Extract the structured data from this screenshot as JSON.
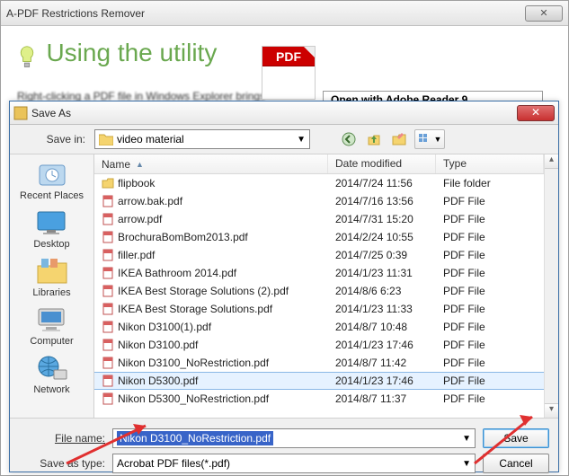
{
  "app": {
    "title": "A-PDF Restrictions Remover",
    "heading": "Using the utility",
    "desc": "Right-clicking a PDF file in Windows Explorer brings",
    "pdf_badge": "PDF",
    "context_item": "Open with Adobe Reader 9"
  },
  "dialog": {
    "title": "Save As",
    "savein_label": "Save in:",
    "folder": "video material",
    "places": [
      {
        "label": "Recent Places"
      },
      {
        "label": "Desktop"
      },
      {
        "label": "Libraries"
      },
      {
        "label": "Computer"
      },
      {
        "label": "Network"
      }
    ],
    "headers": {
      "name": "Name",
      "date": "Date modified",
      "type": "Type"
    },
    "files": [
      {
        "name": "flipbook",
        "date": "2014/7/24 11:56",
        "type": "File folder",
        "kind": "folder"
      },
      {
        "name": "arrow.bak.pdf",
        "date": "2014/7/16 13:56",
        "type": "PDF File",
        "kind": "pdf"
      },
      {
        "name": "arrow.pdf",
        "date": "2014/7/31 15:20",
        "type": "PDF File",
        "kind": "pdf"
      },
      {
        "name": "BrochuraBomBom2013.pdf",
        "date": "2014/2/24 10:55",
        "type": "PDF File",
        "kind": "pdf"
      },
      {
        "name": "filler.pdf",
        "date": "2014/7/25 0:39",
        "type": "PDF File",
        "kind": "pdf"
      },
      {
        "name": "IKEA Bathroom 2014.pdf",
        "date": "2014/1/23 11:31",
        "type": "PDF File",
        "kind": "pdf"
      },
      {
        "name": "IKEA Best Storage Solutions (2).pdf",
        "date": "2014/8/6 6:23",
        "type": "PDF File",
        "kind": "pdf"
      },
      {
        "name": "IKEA Best Storage Solutions.pdf",
        "date": "2014/1/23 11:33",
        "type": "PDF File",
        "kind": "pdf"
      },
      {
        "name": "Nikon D3100(1).pdf",
        "date": "2014/8/7 10:48",
        "type": "PDF File",
        "kind": "pdf"
      },
      {
        "name": "Nikon D3100.pdf",
        "date": "2014/1/23 17:46",
        "type": "PDF File",
        "kind": "pdf"
      },
      {
        "name": "Nikon D3100_NoRestriction.pdf",
        "date": "2014/8/7 11:42",
        "type": "PDF File",
        "kind": "pdf"
      },
      {
        "name": "Nikon D5300.pdf",
        "date": "2014/1/23 17:46",
        "type": "PDF File",
        "kind": "pdf",
        "selected": true
      },
      {
        "name": "Nikon D5300_NoRestriction.pdf",
        "date": "2014/8/7 11:37",
        "type": "PDF File",
        "kind": "pdf"
      }
    ],
    "filename_label": "File name:",
    "filename_value": "Nikon D3100_NoRestriction.pdf",
    "saveastype_label": "Save as type:",
    "saveastype_value": "Acrobat PDF files(*.pdf)",
    "save_btn": "Save",
    "cancel_btn": "Cancel"
  }
}
